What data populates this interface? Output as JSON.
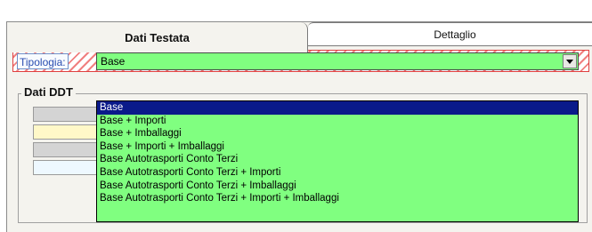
{
  "tabs": [
    {
      "label": "Dati Testata",
      "active": true
    },
    {
      "label": "Dettaglio",
      "active": false
    }
  ],
  "tipologia": {
    "label": "Tipologia:",
    "selected_value": "Base",
    "options": [
      "Base",
      "Base + Importi",
      "Base + Imballaggi",
      "Base + Importi + Imballaggi",
      "Base Autotrasporti Conto Terzi",
      "Base Autotrasporti Conto Terzi + Importi",
      "Base Autotrasporti Conto Terzi + Imballaggi",
      "Base Autotrasporti Conto Terzi + Importi + Imballaggi"
    ],
    "highlighted_index": 0
  },
  "fieldset": {
    "legend": "Dati DDT"
  },
  "colors": {
    "select_bg": "#80ff80",
    "highlight_bg": "#0a1a8a",
    "label_text": "#2a4db0",
    "hatch": "#f08080"
  },
  "icons": {
    "dropdown_arrow": "chevron-down-icon"
  }
}
